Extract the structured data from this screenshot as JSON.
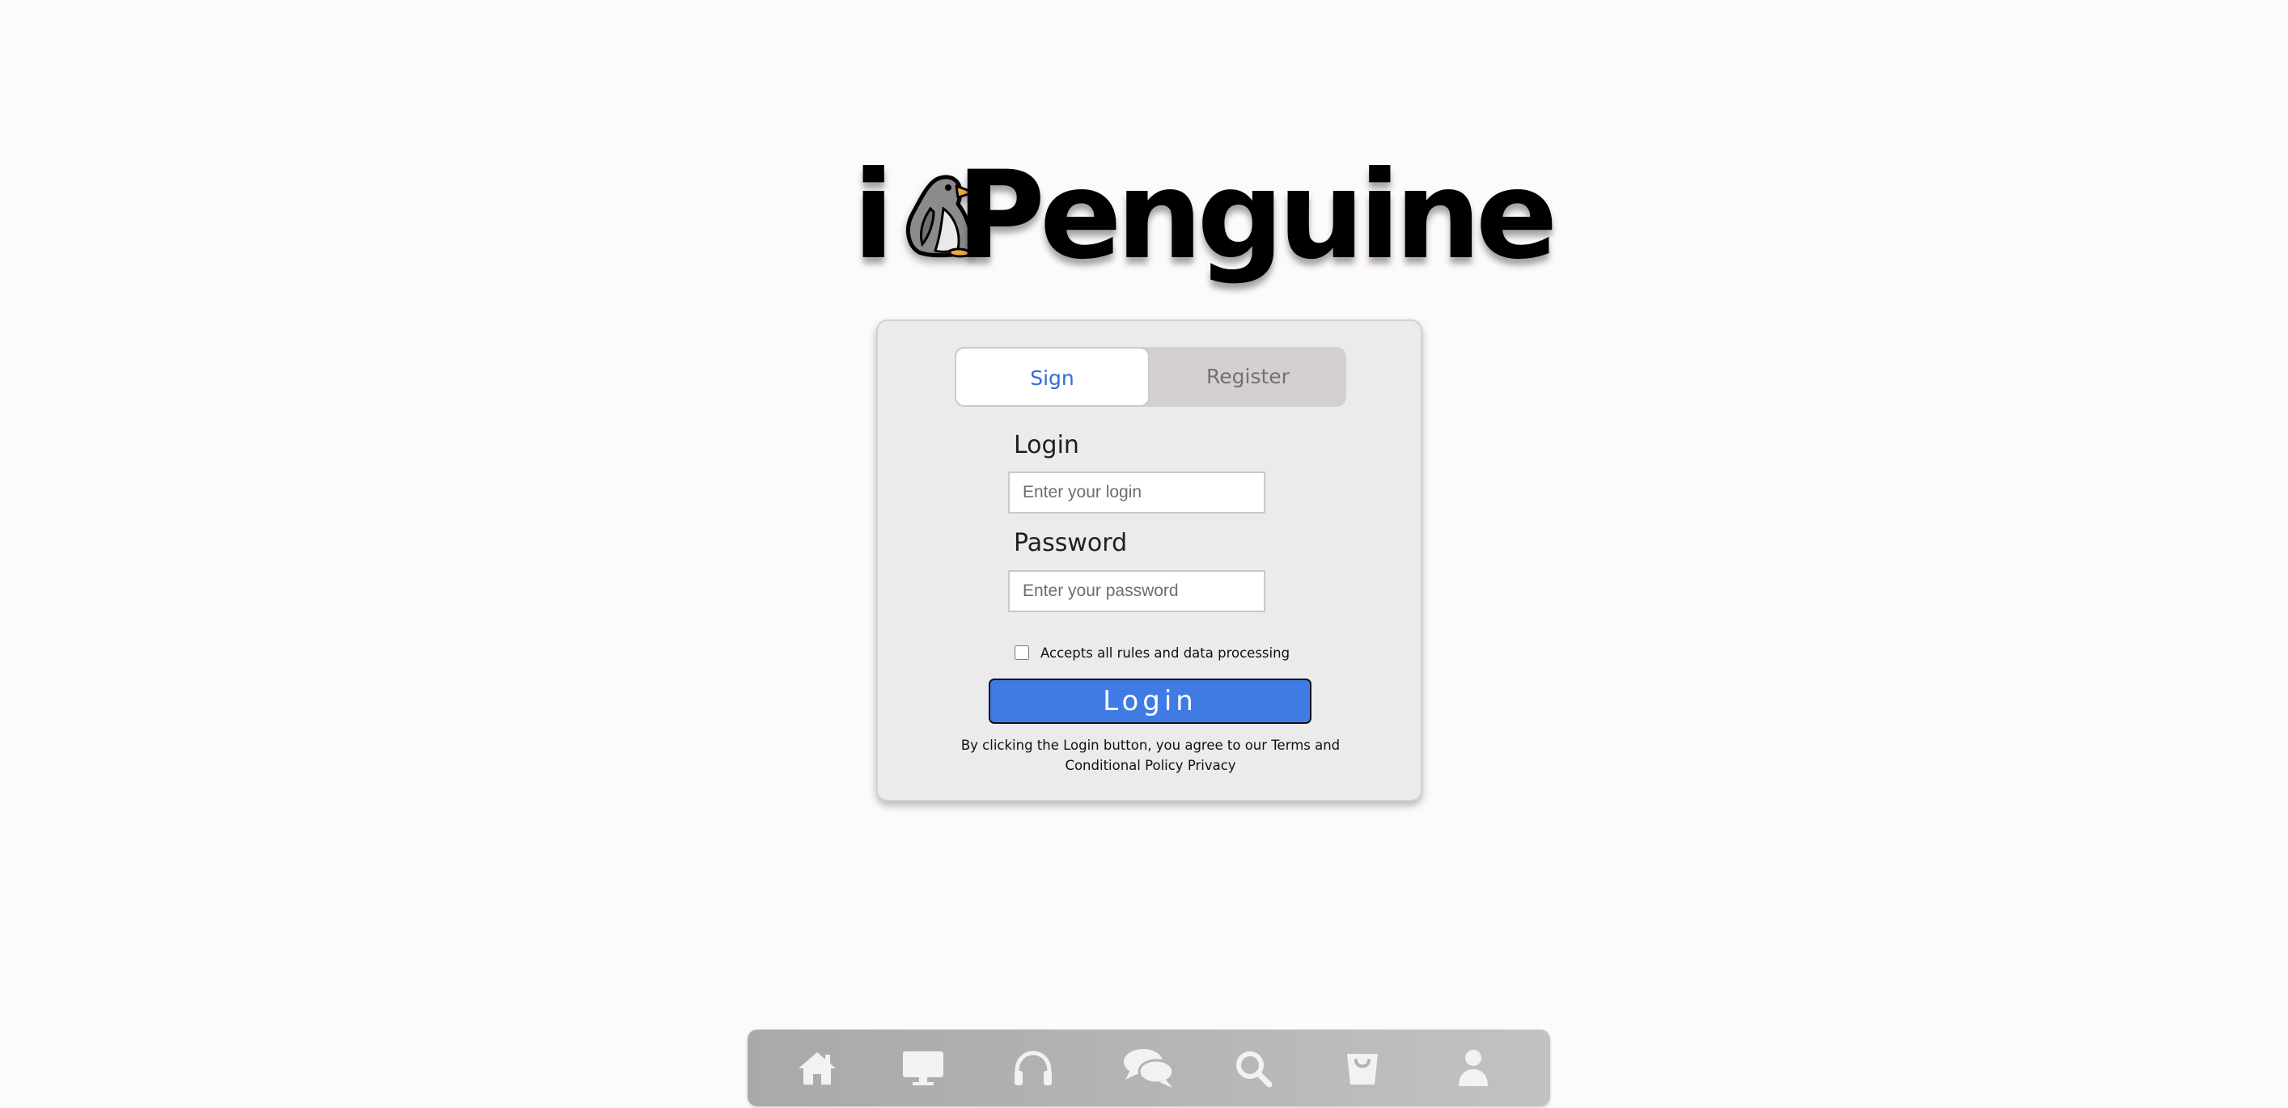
{
  "logo": {
    "prefix": "i",
    "word": "Penguine",
    "mascot_icon": "penguin-icon"
  },
  "auth": {
    "tabs": [
      {
        "label": "Sign",
        "active": true
      },
      {
        "label": "Register",
        "active": false
      }
    ],
    "login": {
      "label": "Login",
      "value": "",
      "placeholder": "Enter your login"
    },
    "password": {
      "label": "Password",
      "value": "",
      "placeholder": "Enter your password"
    },
    "accept": {
      "label": "Accepts all rules and data processing",
      "checked": false
    },
    "submit_label": "Login",
    "terms_text": "By clicking the Login button, you agree to our Terms and Conditional Policy Privacy"
  },
  "nav": {
    "items": [
      {
        "icon": "home-icon"
      },
      {
        "icon": "monitor-icon"
      },
      {
        "icon": "headphones-icon"
      },
      {
        "icon": "chat-icon"
      },
      {
        "icon": "search-icon"
      },
      {
        "icon": "shopping-bag-icon"
      },
      {
        "icon": "user-icon"
      }
    ]
  },
  "colors": {
    "background": "#fdfafb",
    "card": "#ecebec",
    "accent": "#3f7be3",
    "active_tab_text": "#2f6fd6",
    "inactive_tab_text": "#747070",
    "nav_icon": "#f2f2f2"
  }
}
